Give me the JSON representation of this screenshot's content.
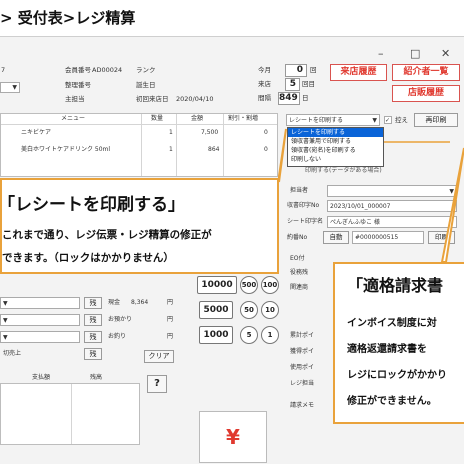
{
  "breadcrumb": "> 受付表>レジ精算",
  "window": {
    "minimize": "–",
    "maximize": "□",
    "close": "✕"
  },
  "member": {
    "member_no_label": "会員番号",
    "member_no": "AD00024",
    "ticket_no_label": "整理番号",
    "doctor_label": "主担当",
    "rank_label": "ランク",
    "birthday_label": "誕生日",
    "first_visit_label": "初回来店日",
    "first_visit": "2020/04/10",
    "left_num": "7"
  },
  "stats": {
    "today_label": "今月",
    "today_value": "0",
    "today_unit": "回",
    "visit_label": "来店",
    "visit_value": "5",
    "visit_unit": "回目",
    "interval_label": "間隔",
    "interval_value": "849",
    "interval_unit": "日"
  },
  "header_buttons": {
    "history": "来店履歴",
    "referrer": "紹介者一覧",
    "store_history": "店販履歴"
  },
  "table": {
    "headers": [
      "メニュー",
      "数量",
      "金額",
      "割引・割増"
    ],
    "rows": [
      {
        "menu": "ニキビケア",
        "qty": "1",
        "amount": "7,500",
        "discount": "0"
      },
      {
        "menu": "美白ホワイトケアドリンク 50ml",
        "qty": "1",
        "amount": "864",
        "discount": "0"
      }
    ]
  },
  "receipt": {
    "select_value": "レシートを印刷する",
    "control_label": "控え",
    "reprint": "再印刷",
    "options": [
      "レシートを印刷する",
      "領収書兼用で印刷する",
      "領収書(宛名)を印刷する",
      "印刷しない"
    ],
    "hidden_text": "印刷する(データがある場合)",
    "handler_label": "担当者",
    "invoice_label": "収書印字No",
    "invoice_value": "2023/10/01_000007",
    "print_name_label": "シート印字名",
    "print_name_value": "ぺんぎんふゆこ 様",
    "reserve_label": "約番No",
    "auto_btn": "自動",
    "reserve_value": "#0000000515",
    "print_btn": "印刷",
    "side_labels": [
      "EO付",
      "役務残",
      "関連商"
    ],
    "lower_labels": [
      "累計ポイ",
      "獲得ポイ",
      "使用ポイ",
      "レジ担当",
      "請求メモ"
    ]
  },
  "payment": {
    "cash_label": "現金",
    "cash_value": "8,364",
    "deposit_label": "お預かり",
    "change_label": "お釣り",
    "unit": "円",
    "remain_short": "残",
    "sales_label": "切売上",
    "pay_label": "支払額",
    "balance_label": "残高",
    "clear": "クリア",
    "help": "?",
    "yen": "¥"
  },
  "denominations": {
    "big": [
      "10000",
      "5000",
      "1000"
    ],
    "coins": [
      "500",
      "100",
      "50",
      "10",
      "5",
      "1"
    ]
  },
  "callout1": {
    "title": "「レシートを印刷する」",
    "line1": "これまで通り、レジ伝票・レジ精算の修正が",
    "line2": "できます。（ロックはかかりません）"
  },
  "callout2": {
    "title": "「適格請求書",
    "line1": "インボイス制度に対",
    "line2": "適格返還請求書を",
    "line3": "レジにロックがかかり",
    "line4": "修正ができません。"
  }
}
